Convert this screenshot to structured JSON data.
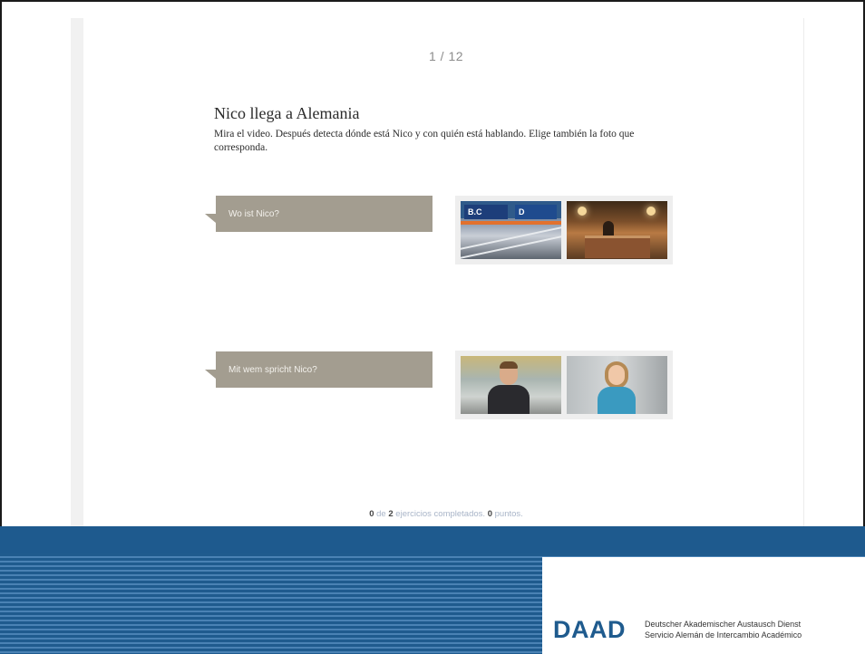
{
  "pager": {
    "text": "1 / 12"
  },
  "exercise": {
    "title": "Nico llega a Alemania",
    "instructions": "Mira el video. Después detecta dónde está Nico y con quién está hablando. Elige también la foto que corresponda."
  },
  "questions": [
    {
      "label": "Wo ist Nico?",
      "sign1": "B.C",
      "sign2": "D"
    },
    {
      "label": "Mit wem spricht Nico?"
    }
  ],
  "progress": {
    "completed": "0",
    "connector": "de",
    "total": "2",
    "suffix": "ejercicios completados.",
    "points": "0",
    "points_label": "puntos."
  },
  "footer": {
    "logo": "DAAD",
    "line1": "Deutscher Akademischer Austausch Dienst",
    "line2": "Servicio Alemán de Intercambio Académico"
  },
  "colors": {
    "question_bg": "#a39d90",
    "brand_blue": "#1f5b8e"
  }
}
